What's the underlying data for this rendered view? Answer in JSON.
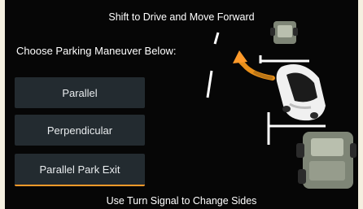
{
  "banner_top": "Shift to Drive and Move Forward",
  "heading": "Choose Parking Maneuver Below:",
  "options": [
    {
      "label": "Parallel",
      "selected": false
    },
    {
      "label": "Perpendicular",
      "selected": false
    },
    {
      "label": "Parallel Park Exit",
      "selected": true
    }
  ],
  "banner_bottom": "Use Turn Signal to Change Sides",
  "colors": {
    "accent": "#ff9a2a",
    "button_bg": "#232b30",
    "screen_bg": "#060606"
  },
  "icons": {
    "direction_arrow": "curved-forward-arrow-icon"
  }
}
